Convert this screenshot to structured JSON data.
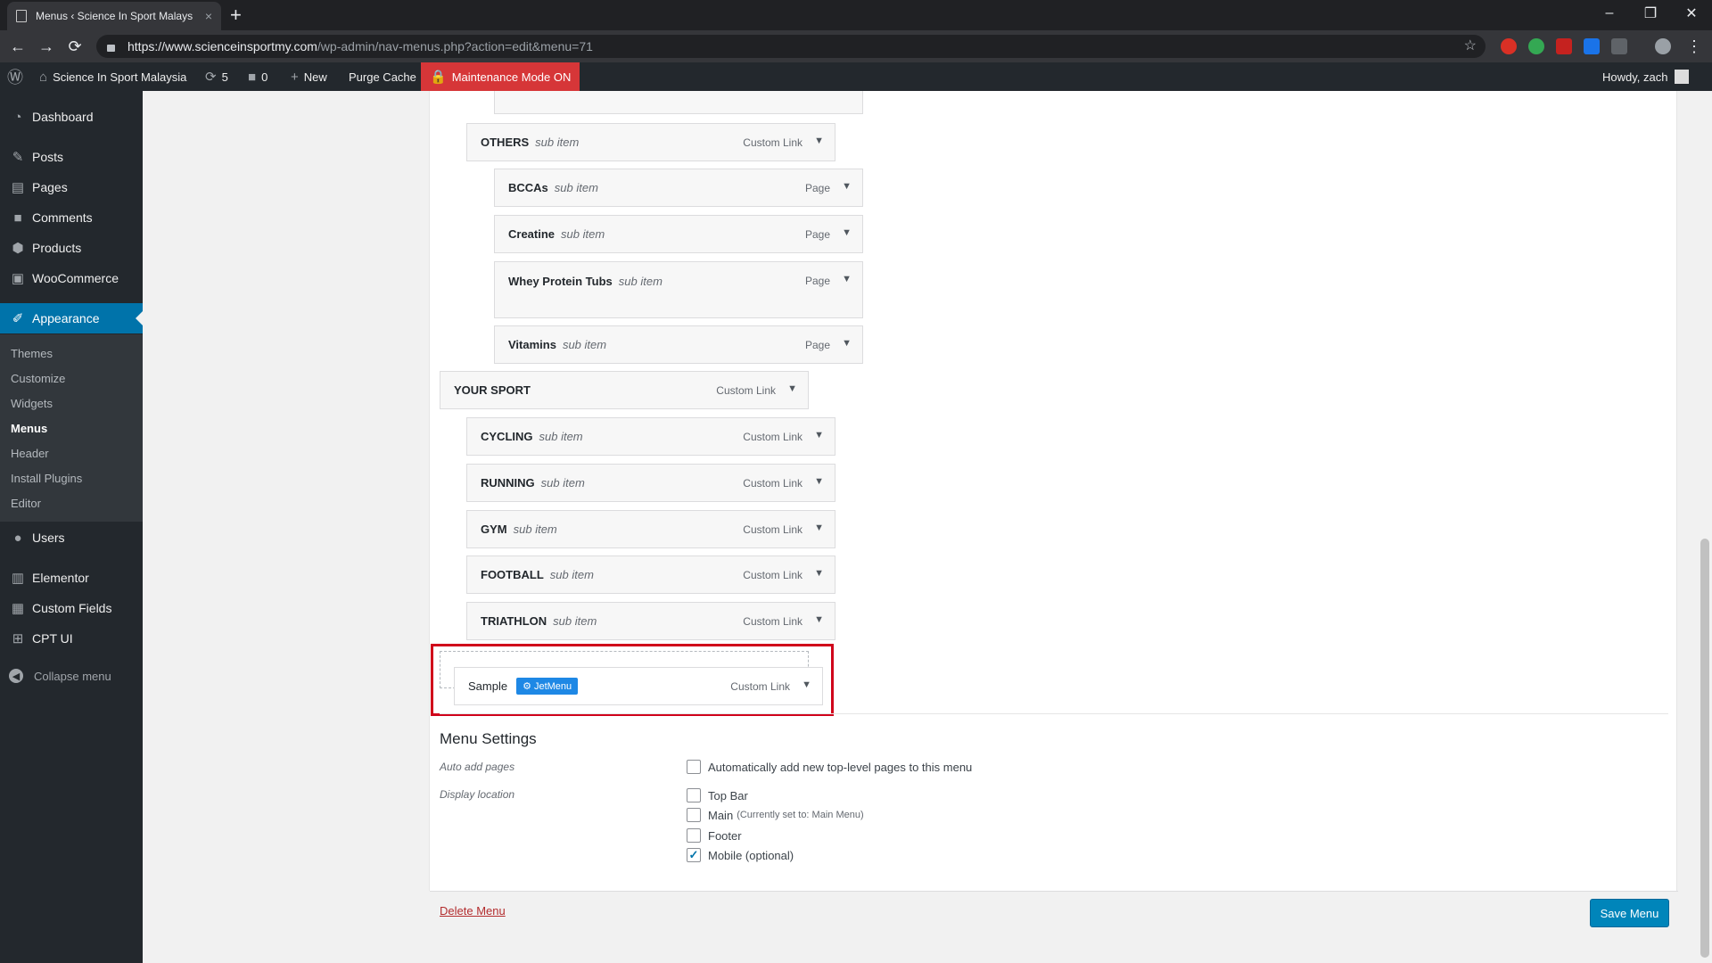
{
  "browser": {
    "tab_title": "Menus ‹ Science In Sport Malays",
    "tab_close": "×",
    "new_tab": "+",
    "url_host": "https://www.scienceinsportmy.com",
    "url_path": "/wp-admin/nav-menus.php?action=edit&menu=71",
    "window_controls": [
      "–",
      "❐",
      "✕"
    ],
    "nav": {
      "back": "←",
      "forward": "→",
      "reload": "⟳",
      "star": "☆"
    }
  },
  "adminbar": {
    "site_name": "Science In Sport Malaysia",
    "updates_count": "5",
    "comments_count": "0",
    "new_label": "New",
    "purge_label": "Purge Cache",
    "maintenance_label": "Maintenance Mode ON",
    "howdy": "Howdy, zach"
  },
  "sidebar": {
    "items": [
      {
        "label": "Dashboard",
        "icon": "dashboard-icon"
      },
      {
        "label": "Posts",
        "icon": "pin-icon"
      },
      {
        "label": "Pages",
        "icon": "pages-icon"
      },
      {
        "label": "Comments",
        "icon": "comment-icon"
      },
      {
        "label": "Products",
        "icon": "box-icon"
      },
      {
        "label": "WooCommerce",
        "icon": "woo-icon"
      },
      {
        "label": "Appearance",
        "icon": "brush-icon"
      },
      {
        "label": "Users",
        "icon": "user-icon"
      },
      {
        "label": "Elementor",
        "icon": "elementor-icon"
      },
      {
        "label": "Custom Fields",
        "icon": "grid-icon"
      },
      {
        "label": "CPT UI",
        "icon": "cpt-icon"
      }
    ],
    "submenu": [
      "Themes",
      "Customize",
      "Widgets",
      "Menus",
      "Header",
      "Install Plugins",
      "Editor"
    ],
    "collapse": "Collapse menu"
  },
  "menu_items": [
    {
      "title": "OTHERS",
      "sub": "sub item",
      "type": "Custom Link"
    },
    {
      "title": "BCCAs",
      "sub": "sub item",
      "type": "Page"
    },
    {
      "title": "Creatine",
      "sub": "sub item",
      "type": "Page"
    },
    {
      "title": "Whey Protein Tubs",
      "sub": "sub item",
      "type": "Page"
    },
    {
      "title": "Vitamins",
      "sub": "sub item",
      "type": "Page"
    },
    {
      "title": "YOUR SPORT",
      "sub": "",
      "type": "Custom Link"
    },
    {
      "title": "CYCLING",
      "sub": "sub item",
      "type": "Custom Link"
    },
    {
      "title": "RUNNING",
      "sub": "sub item",
      "type": "Custom Link"
    },
    {
      "title": "GYM",
      "sub": "sub item",
      "type": "Custom Link"
    },
    {
      "title": "FOOTBALL",
      "sub": "sub item",
      "type": "Custom Link"
    },
    {
      "title": "TRIATHLON",
      "sub": "sub item",
      "type": "Custom Link"
    },
    {
      "title": "Sample",
      "sub": "",
      "type": "Custom Link",
      "badge": "JetMenu"
    }
  ],
  "menu_settings": {
    "title": "Menu Settings",
    "auto_add_label": "Auto add pages",
    "auto_add_option": "Automatically add new top-level pages to this menu",
    "display_location_label": "Display location",
    "locations": [
      {
        "label": "Top Bar",
        "note": "",
        "checked": false
      },
      {
        "label": "Main",
        "note": "(Currently set to: Main Menu)",
        "checked": false
      },
      {
        "label": "Footer",
        "note": "",
        "checked": false
      },
      {
        "label": "Mobile (optional)",
        "note": "",
        "checked": true
      }
    ]
  },
  "actions": {
    "delete": "Delete Menu",
    "save": "Save Menu"
  },
  "colors": {
    "admin_dark": "#23282d",
    "accent": "#0073aa",
    "highlight": "#d0021b",
    "maintenance": "#d63638"
  }
}
